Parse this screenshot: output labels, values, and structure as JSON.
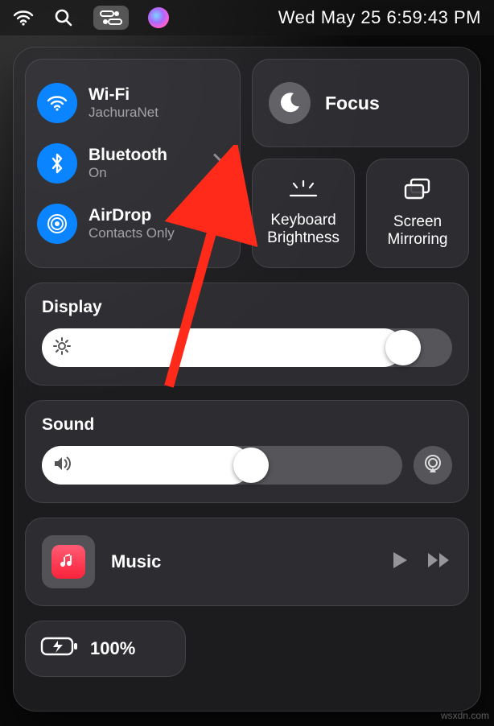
{
  "menubar": {
    "datetime": "Wed May 25  6:59:43 PM"
  },
  "connectivity": {
    "wifi": {
      "title": "Wi-Fi",
      "sub": "JachuraNet"
    },
    "bluetooth": {
      "title": "Bluetooth",
      "sub": "On"
    },
    "airdrop": {
      "title": "AirDrop",
      "sub": "Contacts Only"
    }
  },
  "focus": {
    "label": "Focus"
  },
  "keyboard_brightness": {
    "label_line1": "Keyboard",
    "label_line2": "Brightness"
  },
  "screen_mirroring": {
    "label_line1": "Screen",
    "label_line2": "Mirroring"
  },
  "display": {
    "label": "Display",
    "value_percent": 88
  },
  "sound": {
    "label": "Sound",
    "value_percent": 58
  },
  "music": {
    "title": "Music"
  },
  "battery": {
    "label": "100%"
  },
  "watermark": "wsxdn.com"
}
